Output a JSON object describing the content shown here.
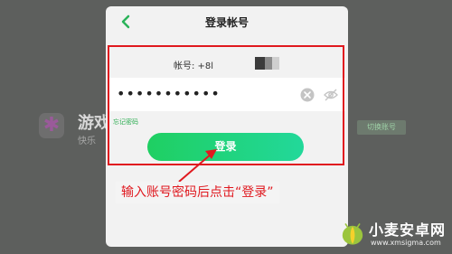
{
  "background_app": {
    "title": "游戏",
    "subtitle": "快乐",
    "switch_label": "切换账号"
  },
  "modal": {
    "title": "登录帐号",
    "account_label": "帐号: +8l",
    "password_masked": "•••••••••••",
    "forgot_password": "忘记密码",
    "login_button": "登录"
  },
  "annotation": {
    "instruction": "输入账号密码后点击“登录”",
    "color": "#e0191f"
  },
  "watermark": {
    "name": "小麦安卓网",
    "url": "www.xmsigma.com"
  },
  "colors": {
    "accent": "#22d370",
    "link": "#2fae54"
  }
}
